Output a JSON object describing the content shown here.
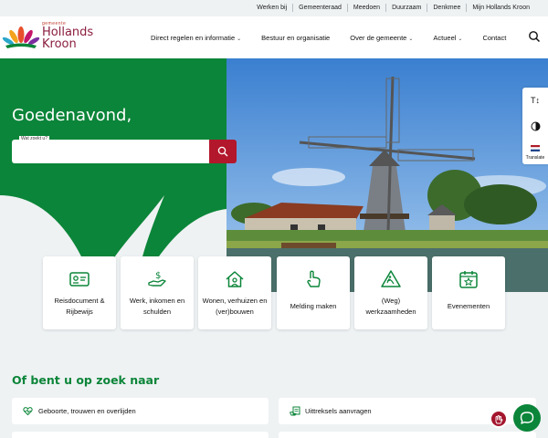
{
  "topbar": {
    "links": [
      "Werken bij",
      "Gemeenteraad",
      "Meedoen",
      "Duurzaam",
      "Denkmee",
      "Mijn Hollands Kroon"
    ]
  },
  "header": {
    "logo_small": "gemeente",
    "logo_line1": "Hollands",
    "logo_line2": "Kroon",
    "nav": [
      {
        "label": "Direct regelen en informatie",
        "dropdown": true
      },
      {
        "label": "Bestuur en organisatie",
        "dropdown": false
      },
      {
        "label": "Over de gemeente",
        "dropdown": true
      },
      {
        "label": "Actueel",
        "dropdown": true
      },
      {
        "label": "Contact",
        "dropdown": false
      }
    ],
    "search_icon": "search-icon"
  },
  "hero": {
    "greeting": "Goedenavond,",
    "search_label": "Wat zoekt u?",
    "search_value": "",
    "image_alt": "windmill-photo"
  },
  "side_tools": {
    "translate_label": "Translate",
    "icons": [
      "text-size-icon",
      "contrast-icon",
      "flag-nl-icon"
    ]
  },
  "tiles": [
    {
      "label": "Reisdocument & Rijbewijs",
      "icon": "id-card-icon"
    },
    {
      "label": "Werk, inkomen en schulden",
      "icon": "money-hand-icon"
    },
    {
      "label": "Wonen, verhuizen en (ver)bouwen",
      "icon": "house-icon"
    },
    {
      "label": "Melding maken",
      "icon": "pointing-hand-icon"
    },
    {
      "label": "(Weg) werkzaamheden",
      "icon": "roadworks-icon"
    },
    {
      "label": "Evenementen",
      "icon": "calendar-star-icon"
    }
  ],
  "lookfor": {
    "title": "Of bent u op zoek naar",
    "links": [
      {
        "label": "Geboorte, trouwen en overlijden",
        "icon": "heart-pulse-icon"
      },
      {
        "label": "Uittreksels aanvragen",
        "icon": "document-hand-icon"
      }
    ]
  },
  "colors": {
    "brand_green": "#0b8539",
    "brand_red": "#b3172c",
    "background": "#eef2f3"
  }
}
